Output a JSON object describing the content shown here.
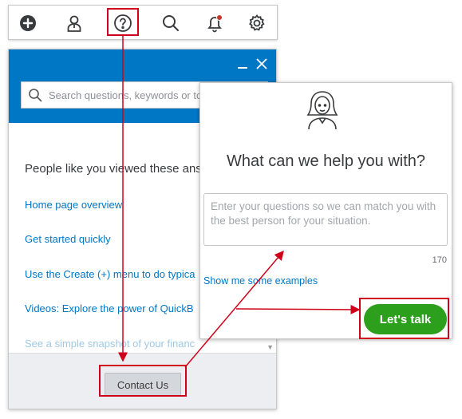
{
  "toolbar": {
    "icons": [
      {
        "name": "add-icon"
      },
      {
        "name": "user-icon"
      },
      {
        "name": "help-icon"
      },
      {
        "name": "search-icon"
      },
      {
        "name": "notification-bell-icon"
      },
      {
        "name": "gear-icon"
      }
    ]
  },
  "help_panel": {
    "search_placeholder": "Search questions, keywords or topics",
    "intro": "People like you viewed these ans",
    "links": [
      "Home page overview",
      "Get started quickly",
      "Use the Create (+) menu to do typica",
      "Videos: Explore the power of QuickB",
      "See a simple snapshot of your financ"
    ],
    "contact_label": "Contact Us"
  },
  "chat": {
    "title": "What can we help you with?",
    "input_placeholder": "Enter your questions so we can match you with the best person for your situation.",
    "char_count": "170",
    "examples_link": "Show me some examples",
    "talk_label": "Let's talk"
  },
  "colors": {
    "brand_blue": "#0077c5",
    "brand_green": "#2ca01c",
    "annotation_red": "#d0021b"
  }
}
